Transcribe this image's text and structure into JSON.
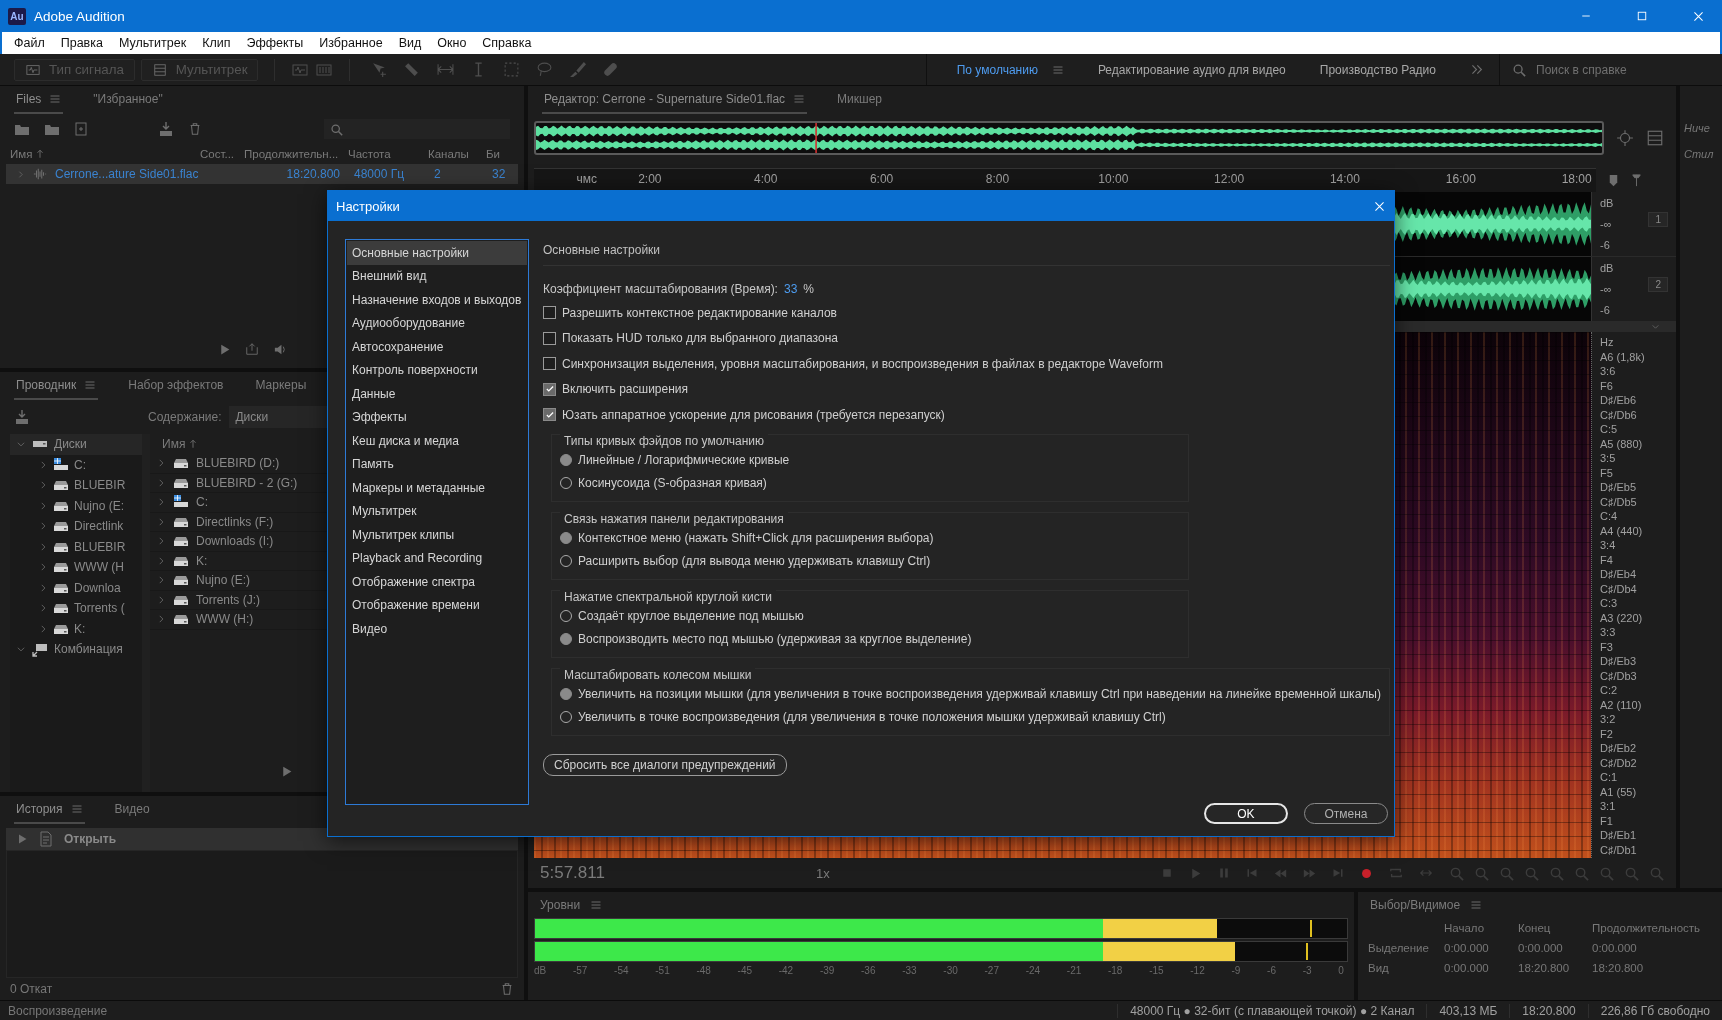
{
  "window": {
    "logo": "Au",
    "title": "Adobe Audition"
  },
  "menu": [
    "Файл",
    "Правка",
    "Мультитрек",
    "Клип",
    "Эффекты",
    "Избранное",
    "Вид",
    "Окно",
    "Справка"
  ],
  "toolbar": {
    "modes": [
      "Тип сигнала",
      "Мультитрек"
    ],
    "workspaces": [
      {
        "label": "По умолчанию",
        "selected": true
      },
      {
        "label": "Редактирование аудио для видео",
        "selected": false
      },
      {
        "label": "Производство Радио",
        "selected": false
      }
    ],
    "search": {
      "placeholder": "Поиск в справке"
    }
  },
  "files_panel": {
    "tabs": [
      {
        "label": "Files",
        "selected": true
      },
      {
        "label": "\"Избранное\"",
        "selected": false
      }
    ],
    "columns": [
      "Имя",
      "Сост...",
      "Продолжительн...",
      "Частота",
      "Каналы",
      "Би"
    ],
    "rows": [
      {
        "cells": [
          "Cerrone...ature Side01.flac",
          "",
          "18:20.800",
          "48000 Гц",
          "2",
          "32"
        ],
        "selected": true
      }
    ]
  },
  "explorer_panel": {
    "tabs": [
      {
        "label": "Проводник",
        "selected": true
      },
      {
        "label": "Набор эффектов",
        "selected": false
      },
      {
        "label": "Маркеры",
        "selected": false
      }
    ],
    "content_label": "Содержание:",
    "content_value": "Диски",
    "tree": [
      {
        "label": "Диски",
        "kind": "group",
        "expanded": true,
        "selected": true,
        "children": [
          {
            "label": "C:",
            "kind": "system",
            "expanded": false,
            "selected": false
          },
          {
            "label": "BLUEBIR",
            "kind": "drive",
            "expanded": false,
            "selected": false
          },
          {
            "label": "Nujno (E:",
            "kind": "drive",
            "expanded": false,
            "selected": false
          },
          {
            "label": "Directlink",
            "kind": "drive",
            "expanded": false,
            "selected": false
          },
          {
            "label": "BLUEBIR",
            "kind": "drive",
            "expanded": false,
            "selected": false
          },
          {
            "label": "WWW (H",
            "kind": "drive",
            "expanded": false,
            "selected": false
          },
          {
            "label": "Downloa",
            "kind": "drive",
            "expanded": false,
            "selected": false
          },
          {
            "label": "Torrents (",
            "kind": "drive",
            "expanded": false,
            "selected": false
          },
          {
            "label": "K:",
            "kind": "drive",
            "expanded": false,
            "selected": false
          }
        ]
      },
      {
        "label": "Комбинация",
        "kind": "combo",
        "expanded": true,
        "selected": false
      }
    ],
    "list_header": "Имя",
    "list": [
      {
        "label": "BLUEBIRD (D:)",
        "kind": "drive"
      },
      {
        "label": "BLUEBIRD - 2 (G:)",
        "kind": "drive"
      },
      {
        "label": "C:",
        "kind": "system"
      },
      {
        "label": "Directlinks (F:)",
        "kind": "drive"
      },
      {
        "label": "Downloads (I:)",
        "kind": "drive"
      },
      {
        "label": "K:",
        "kind": "drive"
      },
      {
        "label": "Nujno (E:)",
        "kind": "drive"
      },
      {
        "label": "Torrents (J:)",
        "kind": "drive"
      },
      {
        "label": "WWW (H:)",
        "kind": "drive"
      }
    ]
  },
  "history_panel": {
    "tabs": [
      {
        "label": "История",
        "selected": true
      },
      {
        "label": "Видео",
        "selected": false
      }
    ],
    "rows": [
      {
        "label": "Открыть",
        "selected": true
      }
    ],
    "footer": "0 Откат"
  },
  "status_left": "Воспроизведение",
  "editor": {
    "tabs": [
      {
        "label": "Редактор: Cerrone - Supernature Side01.flac",
        "selected": true
      },
      {
        "label": "Микшер",
        "selected": false
      }
    ],
    "ruler": [
      "чмс",
      "2:00",
      "4:00",
      "6:00",
      "8:00",
      "10:00",
      "12:00",
      "14:00",
      "16:00",
      "18:00"
    ],
    "channels": [
      {
        "badge": "1",
        "scale": [
          "dB",
          "-∞",
          "-6"
        ]
      },
      {
        "badge": "2",
        "scale": [
          "dB",
          "-∞",
          "-6"
        ]
      }
    ],
    "spectrum_scale": [
      "Hz",
      "A6 (1,8k)",
      "3:6",
      "F6",
      "D♯/Eb6",
      "C♯/Db6",
      "C:5",
      "A5 (880)",
      "3:5",
      "F5",
      "D♯/Eb5",
      "C♯/Db5",
      "C:4",
      "A4 (440)",
      "3:4",
      "F4",
      "D♯/Eb4",
      "C♯/Db4",
      "C:3",
      "A3 (220)",
      "3:3",
      "F3",
      "D♯/Eb3",
      "C♯/Db3",
      "C:2",
      "A2 (110)",
      "3:2",
      "F2",
      "D♯/Eb2",
      "C♯/Db2",
      "C:1",
      "A1 (55)",
      "3:1",
      "F1",
      "D♯/Eb1",
      "C♯/Db1"
    ],
    "time": "5:57.811",
    "speed": "1x",
    "side_strip": [
      "Ниче",
      "Стил"
    ]
  },
  "levels": {
    "title": "Уровни",
    "meters": [
      {
        "level": 0.84,
        "peak_hold": {
          "level": 0.955
        }
      },
      {
        "level": 0.862,
        "peak_hold": {
          "level": 0.95
        }
      }
    ],
    "scale": [
      "dB",
      "-57",
      "-54",
      "-51",
      "-48",
      "-45",
      "-42",
      "-39",
      "-36",
      "-33",
      "-30",
      "-27",
      "-24",
      "-21",
      "-18",
      "-15",
      "-12",
      "-9",
      "-6",
      "-3",
      "0"
    ]
  },
  "selection_panel": {
    "title": "Выбор/Видимое",
    "columns": [
      "Начало",
      "Конец",
      "Продолжительность"
    ],
    "rows": [
      {
        "label": "Выделение",
        "values": [
          "0:00.000",
          "0:00.000",
          "0:00.000"
        ]
      },
      {
        "label": "Вид",
        "values": [
          "0:00.000",
          "18:20.800",
          "18:20.800"
        ]
      }
    ]
  },
  "status_bar": [
    "48000 Гц ● 32-бит (с плавающей точкой) ● 2 Канал",
    "403,13 МБ",
    "18:20.800",
    "226,86 Гб свободно"
  ],
  "dialog": {
    "title": "Настройки",
    "categories": [
      {
        "label": "Основные настройки",
        "selected": true
      },
      {
        "label": "Внешний вид",
        "selected": false
      },
      {
        "label": "Назначение входов и выходов",
        "selected": false
      },
      {
        "label": "Аудиооборудование",
        "selected": false
      },
      {
        "label": "Автосохранение",
        "selected": false
      },
      {
        "label": "Контроль поверхности",
        "selected": false
      },
      {
        "label": "Данные",
        "selected": false
      },
      {
        "label": "Эффекты",
        "selected": false
      },
      {
        "label": "Кеш диска и медиа",
        "selected": false
      },
      {
        "label": "Память",
        "selected": false
      },
      {
        "label": "Маркеры и метаданные",
        "selected": false
      },
      {
        "label": "Мультитрек",
        "selected": false
      },
      {
        "label": "Мультитрек клипы",
        "selected": false
      },
      {
        "label": "Playback and Recording",
        "selected": false
      },
      {
        "label": "Отображение спектра",
        "selected": false
      },
      {
        "label": "Отображение времени",
        "selected": false
      },
      {
        "label": "Видео",
        "selected": false
      }
    ],
    "heading": "Основные настройки",
    "zoom_factor": {
      "label": "Коэффициент масштабирования (Время):",
      "value": "33",
      "unit": "%"
    },
    "checkboxes": [
      {
        "label": "Разрешить контекстное редактирование каналов",
        "checked": false
      },
      {
        "label": "Показать HUD только для выбранного диапазона",
        "checked": false
      },
      {
        "label": "Синхронизация выделения, уровня масштабирования, и воспроизведения в файлах в редакторе Waveform",
        "checked": false
      },
      {
        "label": "Включить расширения",
        "checked": true
      },
      {
        "label": "Юзать аппаратное ускорение для рисования (требуется перезапуск)",
        "checked": true
      }
    ],
    "groups": [
      {
        "title": "Типы кривых фэйдов по умолчанию",
        "options": [
          {
            "label": "Линейные / Логарифмические кривые",
            "selected": true
          },
          {
            "label": "Косинусоида (S-образная кривая)",
            "selected": false
          }
        ]
      },
      {
        "title": "Связь нажатия панели редактирования",
        "options": [
          {
            "label": "Контекстное меню (нажать Shift+Click для расширения выбора)",
            "selected": true
          },
          {
            "label": "Расширить выбор (для вывода меню удерживать клавишу Ctrl)",
            "selected": false
          }
        ]
      },
      {
        "title": "Нажатие спектральной круглой кисти",
        "options": [
          {
            "label": "Создаёт круглое выделение под мышью",
            "selected": false
          },
          {
            "label": "Воспроизводить место под мышью (удерживая за круглое выделение)",
            "selected": true
          }
        ]
      },
      {
        "title": "Масштабировать колесом мышки",
        "options": [
          {
            "label": "Увеличить на позиции мышки (для увеличения в точке воспроизведения удерживай клавишу Ctrl при наведении на линейке временной шкалы)",
            "selected": true
          },
          {
            "label": "Увеличить в точке воспроизведения (для увеличения в точке положения мышки удерживай клавишу Ctrl)",
            "selected": false
          }
        ]
      }
    ],
    "reset_button": "Сбросить все диалоги предупреждений",
    "buttons": [
      {
        "label": "OK",
        "kind": "primary"
      },
      {
        "label": "Отмена",
        "kind": "secondary"
      }
    ]
  }
}
